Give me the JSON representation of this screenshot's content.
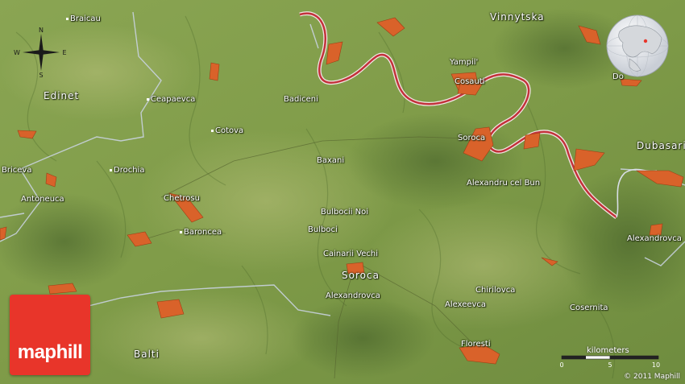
{
  "map": {
    "places": [
      {
        "name": "Braicau",
        "style": "small"
      },
      {
        "name": "Vinnytska",
        "style": "region"
      },
      {
        "name": "Edinet",
        "style": "big"
      },
      {
        "name": "Ceapaevca",
        "style": "small"
      },
      {
        "name": "Badiceni",
        "style": "small"
      },
      {
        "name": "Yampil'",
        "style": "small"
      },
      {
        "name": "Cosauti",
        "style": "small"
      },
      {
        "name": "Do",
        "style": "small"
      },
      {
        "name": "Cotova",
        "style": "small"
      },
      {
        "name": "Soroca",
        "style": "small"
      },
      {
        "name": "Dubasari",
        "style": "big"
      },
      {
        "name": "Briceva",
        "style": "small"
      },
      {
        "name": "Baxani",
        "style": "small"
      },
      {
        "name": "Drochia",
        "style": "small"
      },
      {
        "name": "Alexandru cel Bun",
        "style": "small"
      },
      {
        "name": "Antoneuca",
        "style": "small"
      },
      {
        "name": "Chetrosu",
        "style": "small"
      },
      {
        "name": "Bulbocii Noi",
        "style": "small"
      },
      {
        "name": "Bulboci",
        "style": "small"
      },
      {
        "name": "Baroncea",
        "style": "small"
      },
      {
        "name": "Alexandrovca",
        "style": "small"
      },
      {
        "name": "Cainarii Vechi",
        "style": "small"
      },
      {
        "name": "Soroca",
        "style": "big"
      },
      {
        "name": "Chirilovca",
        "style": "small"
      },
      {
        "name": "Alexandrovca",
        "style": "small"
      },
      {
        "name": "Alexeevca",
        "style": "small"
      },
      {
        "name": "Cosernita",
        "style": "small"
      },
      {
        "name": "Balti",
        "style": "big"
      },
      {
        "name": "Floresti",
        "style": "small"
      }
    ],
    "compass": {
      "n": "N",
      "s": "S",
      "e": "E",
      "w": "W"
    },
    "brand": "maphill",
    "scale": {
      "title": "kilometers",
      "ticks": [
        "0",
        "5",
        "10"
      ]
    },
    "copyright": "© 2011 Maphill",
    "colors": {
      "river": "#c2323a",
      "urban": "#d9622a",
      "road": "#c8d2de",
      "terrain": "#7f9a4a"
    }
  }
}
